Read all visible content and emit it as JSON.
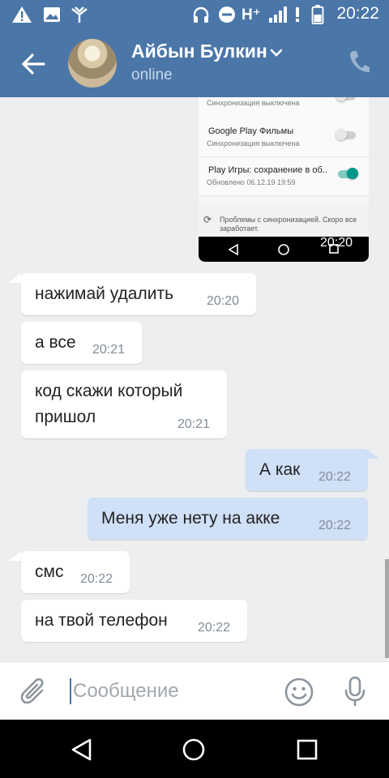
{
  "status_bar": {
    "time": "20:22",
    "network": "H⁺"
  },
  "header": {
    "contact_name": "Айбын Булкин",
    "status": "online"
  },
  "screenshot": {
    "rows": [
      {
        "title": "",
        "subtitle": "Синхронизация выключена",
        "toggle": "off"
      },
      {
        "title": "Google Play Фильмы",
        "subtitle": "Синхронизация выключена",
        "toggle": "off"
      },
      {
        "title": "Play Игры: сохранение в об..",
        "subtitle": "Обновлено 06.12.19 19:59",
        "toggle": "on"
      }
    ],
    "sync_problem": "Проблемы с синхронизацией. Скоро все заработает.",
    "time": "20:20"
  },
  "messages": [
    {
      "direction": "in",
      "text": "нажимай удалить",
      "time": "20:20"
    },
    {
      "direction": "in",
      "text": "а все",
      "time": "20:21"
    },
    {
      "direction": "in",
      "text_line1": "код скажи который",
      "text_line2": "пришол",
      "time": "20:21"
    },
    {
      "direction": "out",
      "text": "А как",
      "time": "20:22"
    },
    {
      "direction": "out",
      "text": "Меня уже нету на акке",
      "time": "20:22"
    },
    {
      "direction": "in",
      "text": "смс",
      "time": "20:22"
    },
    {
      "direction": "in",
      "text": "на твой телефон",
      "time": "20:22"
    }
  ],
  "composer": {
    "placeholder": "Сообщение"
  },
  "icons": {
    "back": "arrow-left-icon",
    "phone": "phone-icon",
    "attach": "paperclip-icon",
    "emoji": "smile-icon",
    "mic": "microphone-icon"
  },
  "colors": {
    "header": "#4a76a8",
    "outgoing_bubble": "#cfe0f7",
    "incoming_bubble": "#ffffff",
    "background": "#edeef0"
  }
}
